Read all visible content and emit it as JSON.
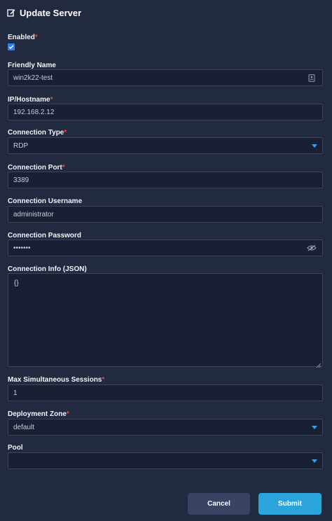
{
  "dialog": {
    "title": "Update Server",
    "title_icon": "edit-icon"
  },
  "form": {
    "enabled": {
      "label": "Enabled",
      "required": true,
      "checked": true
    },
    "friendly_name": {
      "label": "Friendly Name",
      "value": "win2k22-test",
      "icon": "contact-card-icon"
    },
    "ip_hostname": {
      "label": "IP/Hostname",
      "required": true,
      "value": "192.168.2.12"
    },
    "connection_type": {
      "label": "Connection Type",
      "required": true,
      "value": "RDP"
    },
    "connection_port": {
      "label": "Connection Port",
      "required": true,
      "value": "3389"
    },
    "connection_username": {
      "label": "Connection Username",
      "value": "administrator"
    },
    "connection_password": {
      "label": "Connection Password",
      "value": "•••••••",
      "icon": "eye-slash-icon"
    },
    "connection_info": {
      "label": "Connection Info (JSON)",
      "value": "{}"
    },
    "max_sessions": {
      "label": "Max Simultaneous Sessions",
      "required": true,
      "value": "1"
    },
    "deployment_zone": {
      "label": "Deployment Zone",
      "required": true,
      "value": "default"
    },
    "pool": {
      "label": "Pool",
      "value": ""
    }
  },
  "buttons": {
    "cancel": "Cancel",
    "submit": "Submit"
  },
  "colors": {
    "background": "#222a40",
    "field_background": "#1a2033",
    "accent": "#2aa4db",
    "required": "#e5474b"
  }
}
